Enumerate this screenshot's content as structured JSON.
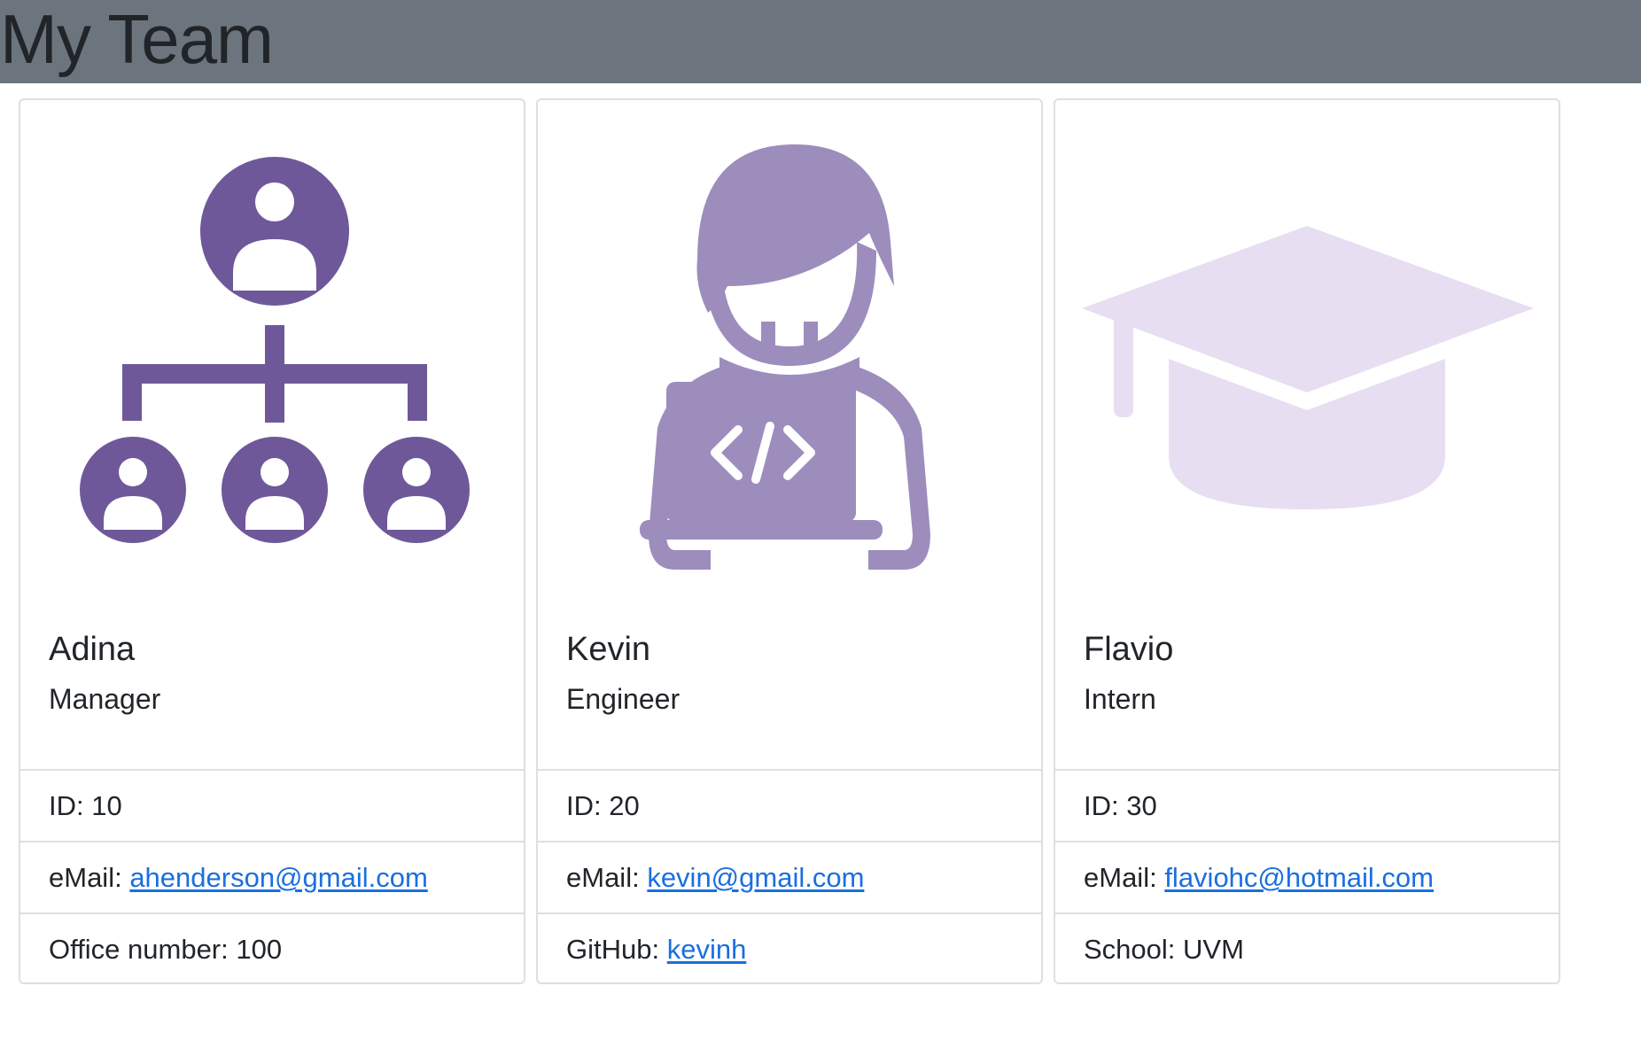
{
  "page": {
    "title": "My Team",
    "header_bg": "#6c757d",
    "link_color": "#1a6fe0"
  },
  "cards": [
    {
      "icon": "org-chart-icon",
      "icon_color": "#6e5899",
      "name": "Adina",
      "role": "Manager",
      "id_text": "ID: 10",
      "email_label": "eMail: ",
      "email": "ahenderson@gmail.com",
      "extra_label": "Office number: 100",
      "extra_link": ""
    },
    {
      "icon": "developer-laptop-icon",
      "icon_color": "#9d8dbd",
      "name": "Kevin",
      "role": "Engineer",
      "id_text": "ID: 20",
      "email_label": "eMail: ",
      "email": "kevin@gmail.com",
      "extra_label": "GitHub: ",
      "extra_link": "kevinh"
    },
    {
      "icon": "graduation-cap-icon",
      "icon_color": "#e8def2",
      "name": "Flavio",
      "role": "Intern",
      "id_text": "ID: 30",
      "email_label": "eMail: ",
      "email": "flaviohc@hotmail.com",
      "extra_label": "School: UVM",
      "extra_link": ""
    }
  ]
}
